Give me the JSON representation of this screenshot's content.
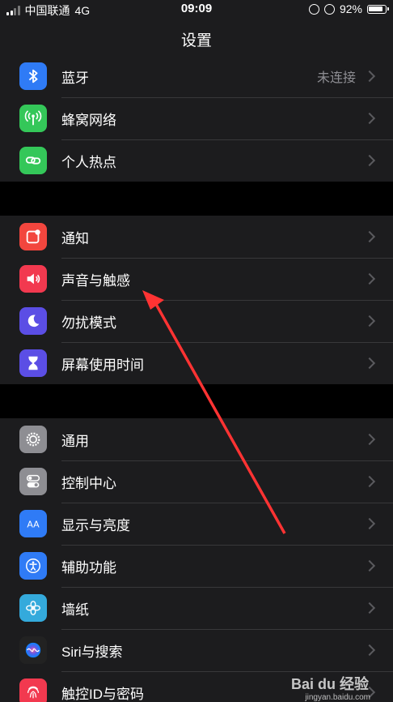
{
  "status_bar": {
    "carrier": "中国联通",
    "network": "4G",
    "time": "09:09",
    "battery_percent": "92%",
    "battery_level": 0.92
  },
  "nav": {
    "title": "设置"
  },
  "groups": [
    {
      "items": [
        {
          "label": "蓝牙",
          "value": "未连接",
          "icon": "bluetooth-icon",
          "color": "#2f7bf6"
        },
        {
          "label": "蜂窝网络",
          "icon": "cellular-icon",
          "color": "#34c759"
        },
        {
          "label": "个人热点",
          "icon": "hotspot-icon",
          "color": "#34c759"
        }
      ]
    },
    {
      "items": [
        {
          "label": "通知",
          "icon": "notifications-icon",
          "color": "#f2463e"
        },
        {
          "label": "声音与触感",
          "icon": "sound-icon",
          "color": "#f2394f"
        },
        {
          "label": "勿扰模式",
          "icon": "moon-icon",
          "color": "#5b4ee5"
        },
        {
          "label": "屏幕使用时间",
          "icon": "hourglass-icon",
          "color": "#5b4ee5"
        }
      ]
    },
    {
      "items": [
        {
          "label": "通用",
          "icon": "gear-icon",
          "color": "#8e8e93"
        },
        {
          "label": "控制中心",
          "icon": "toggles-icon",
          "color": "#8e8e93"
        },
        {
          "label": "显示与亮度",
          "icon": "display-icon",
          "color": "#2f7bf6"
        },
        {
          "label": "辅助功能",
          "icon": "accessibility-icon",
          "color": "#2f7bf6"
        },
        {
          "label": "墙纸",
          "icon": "wallpaper-icon",
          "color": "#34aadc"
        },
        {
          "label": "Siri与搜索",
          "icon": "siri-icon",
          "color": "#222222"
        },
        {
          "label": "触控ID与密码",
          "icon": "fingerprint-icon",
          "color": "#f2394f"
        }
      ]
    }
  ],
  "watermark": {
    "text": "Bai du 经验",
    "sub": "jingyan.baidu.com"
  }
}
